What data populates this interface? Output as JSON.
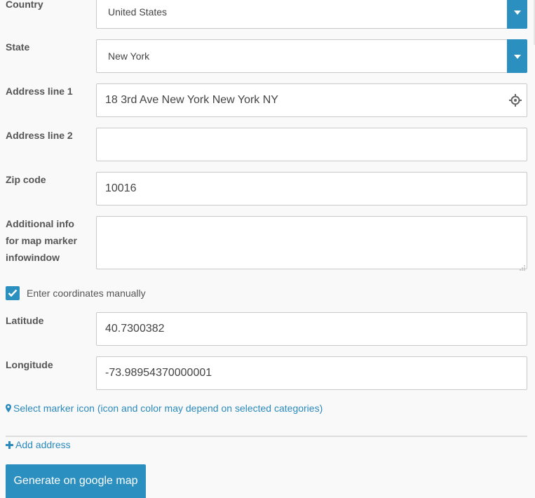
{
  "country": {
    "label": "Country",
    "value": "United States"
  },
  "state": {
    "label": "State",
    "value": "New York"
  },
  "address1": {
    "label": "Address line 1",
    "value": "18 3rd Ave New York New York NY"
  },
  "address2": {
    "label": "Address line 2",
    "value": ""
  },
  "zip": {
    "label": "Zip code",
    "value": "10016"
  },
  "info": {
    "label_lines": [
      "Additional info",
      "for map marker",
      "infowindow"
    ],
    "value": ""
  },
  "manual": {
    "label": "Enter coordinates manually",
    "checked": true
  },
  "latitude": {
    "label": "Latitude",
    "value": "40.7300382"
  },
  "longitude": {
    "label": "Longitude",
    "value": "-73.98954370000001"
  },
  "marker_link": {
    "label": "Select marker icon (icon and color may depend on selected categories)",
    "icon": "map-marker-icon"
  },
  "add_link": {
    "label": "Add address",
    "icon": "plus-icon"
  },
  "generate_button": {
    "label": "Generate on google map"
  },
  "colors": {
    "accent": "#2b8fc0",
    "link": "#2a8abd",
    "label": "#555555",
    "border": "#c9c9c9"
  }
}
